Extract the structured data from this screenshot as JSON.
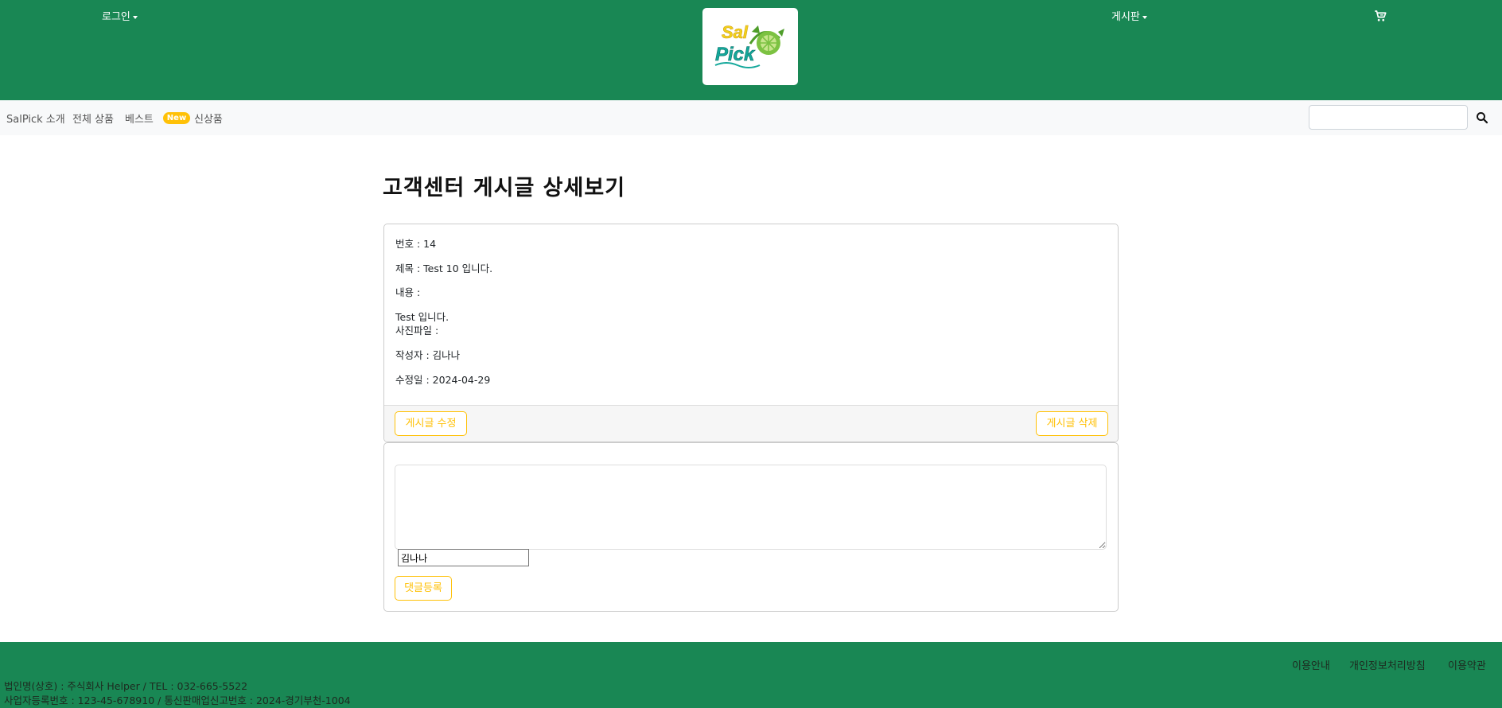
{
  "header": {
    "login_label": "로그인",
    "board_label": "게시판",
    "logo_line1": "Sal",
    "logo_line2": "Pick",
    "cart_icon": "cart-icon"
  },
  "nav": {
    "items": [
      "SalPick 소개",
      "전체 상품",
      "베스트",
      "신상품"
    ],
    "new_badge": "New",
    "search_placeholder": "",
    "search_icon": "search-icon"
  },
  "post": {
    "page_title": "고객센터 게시글 상세보기",
    "number_line": "번호 : 14",
    "title_line": "제목 : Test 10 입니다.",
    "content_label": "내용 :",
    "content_text": "Test 입니다.",
    "photo_label": "사진파일 :",
    "writer_line": "작성자 : 김나나",
    "date_line": "수정일 : 2024-04-29",
    "edit_button": "게시글 수정",
    "delete_button": "게시글 삭제"
  },
  "comment": {
    "textarea_value": "",
    "writer_value": "김나나",
    "submit_button": "댓글등록"
  },
  "footer": {
    "links": [
      "이용안내",
      "개인정보처리방침",
      "이용약관"
    ],
    "company_line": "법인명(상호) : 주식회사 Helper / TEL : 032-665-5522",
    "registration_line": "사업자등록번호 : 123-45-678910 / 통신판매업신고번호 : 2024-경기부천-1004"
  },
  "colors": {
    "brand_green": "#198754",
    "accent_yellow": "#ffc107",
    "navbar_bg": "#f8f9fa",
    "logo_yellow": "#f2d21a",
    "logo_teal": "#14a89b",
    "logo_lime": "#7cc242"
  }
}
